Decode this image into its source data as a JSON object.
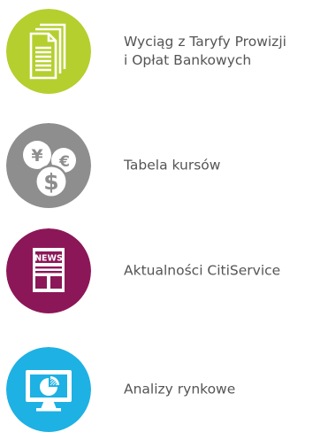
{
  "items": [
    {
      "lines": [
        "Wyciąg z Taryfy Prowizji",
        "i Opłat Bankowych"
      ],
      "icon": "documents-icon",
      "color": "#b5cf2f"
    },
    {
      "lines": [
        "Tabela kursów"
      ],
      "icon": "currency-coins-icon",
      "color": "#8e8e8e",
      "symbols": [
        "¥",
        "€",
        "$"
      ]
    },
    {
      "lines": [
        "Aktualności CitiService"
      ],
      "icon": "newspaper-icon",
      "color": "#8c1758",
      "badge": "NEWS"
    },
    {
      "lines": [
        "Analizy rynkowe"
      ],
      "icon": "monitor-chart-icon",
      "color": "#1eb1e3"
    }
  ]
}
